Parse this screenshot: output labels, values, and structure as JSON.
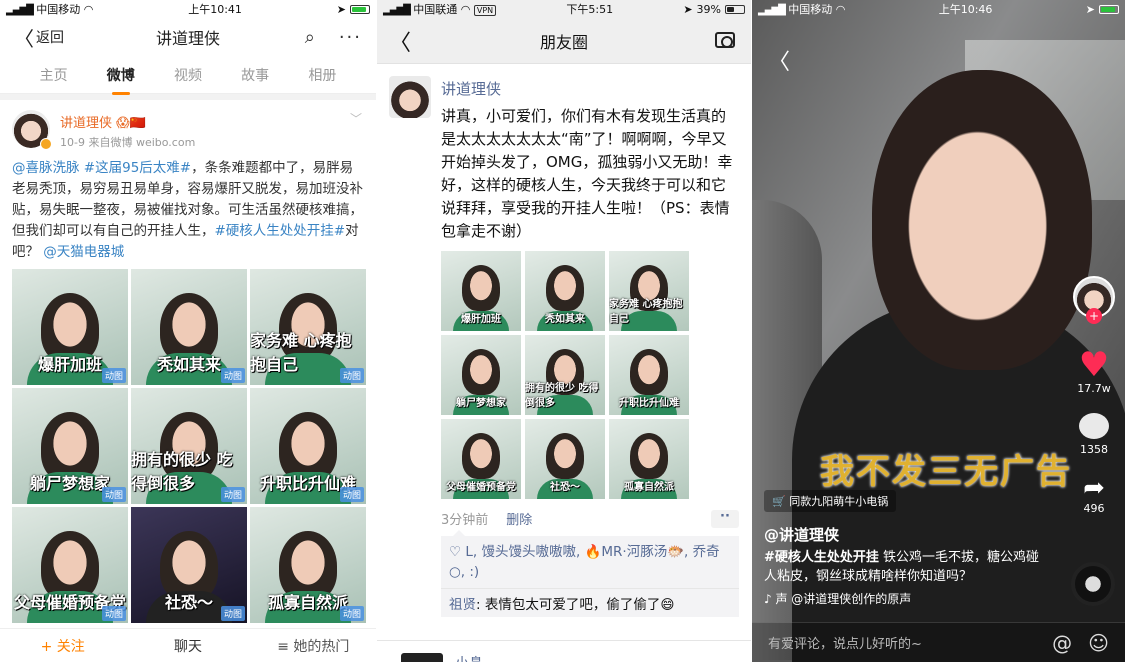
{
  "weibo": {
    "status": {
      "carrier": "中国移动",
      "time": "上午10:41"
    },
    "nav": {
      "back": "返回",
      "title": "讲道理侠"
    },
    "tabs": [
      "主页",
      "微博",
      "视频",
      "故事",
      "相册"
    ],
    "post": {
      "name": "讲道理侠",
      "meta": "10-9  来自微博 weibo.com",
      "text_parts": [
        "@喜脉洗脉",
        "#这届95后太难#",
        "，条条难题都中了，易胖易老易秃顶，易穷易丑易单身，容易爆肝又脱发，易加班没补贴，易失眠一整夜，易被催找对象。可生活虽然硬核难搞，但我们却可以有自己的开挂人生，",
        "#硬核人生处处开挂#",
        "对吧？",
        "@天猫电器城"
      ],
      "images": [
        {
          "caption": "爆肝加班",
          "dark": false
        },
        {
          "caption": "秃如其来",
          "dark": false
        },
        {
          "caption": "家务难 心疼抱抱自己",
          "dark": false
        },
        {
          "caption": "躺尸梦想家",
          "dark": false
        },
        {
          "caption": "拥有的很少 吃得倒很多",
          "dark": false
        },
        {
          "caption": "升职比升仙难",
          "dark": false
        },
        {
          "caption": "父母催婚预备党",
          "dark": false
        },
        {
          "caption": "社恐～",
          "dark": true
        },
        {
          "caption": "孤寡自然派",
          "dark": false
        }
      ],
      "gif_badge": "动图"
    },
    "footer": {
      "follow": "+ 关注",
      "chat": "聊天",
      "hot": "≡ 她的热门"
    }
  },
  "moments": {
    "status": {
      "carrier": "中国联通",
      "vpn": "VPN",
      "time": "下午5:51",
      "battery": "39%"
    },
    "nav": {
      "title": "朋友圈"
    },
    "post": {
      "name": "讲道理侠",
      "text": "讲真，小可爱们，你们有木有发现生活真的是太太太太太太太“南”了！啊啊啊，今早又开始掉头发了，OMG，孤独弱小又无助！幸好，这样的硬核人生，今天我终于可以和它说拜拜，享受我的开挂人生啦！（PS：表情包拿走不谢）",
      "images": [
        {
          "caption": "爆肝加班",
          "dark": false
        },
        {
          "caption": "秃如其来",
          "dark": false
        },
        {
          "caption": "家务难 心疼抱抱自己",
          "dark": false
        },
        {
          "caption": "躺尸梦想家",
          "dark": false
        },
        {
          "caption": "拥有的很少 吃得倒很多",
          "dark": false
        },
        {
          "caption": "升职比升仙难",
          "dark": false
        },
        {
          "caption": "父母催婚预备党",
          "dark": false
        },
        {
          "caption": "社恐～",
          "dark": true
        },
        {
          "caption": "孤寡自然派",
          "dark": false
        }
      ],
      "time": "3分钟前",
      "delete": "删除",
      "likes": "♡ L, 馒头馒头嗷嗷嗷, 🔥MR·河豚汤🐡, 乔奇○, :)",
      "comment_user": "祖贤",
      "comment_text": ": 表情包太可爱了吧，偷了偷了😄"
    },
    "next_name": "小鼻"
  },
  "douyin": {
    "status": {
      "carrier": "中国移动",
      "time": "上午10:46"
    },
    "likes": "17.7w",
    "comments": "1358",
    "shares": "496",
    "overlay_caption": "我不发三无广告",
    "product": "同款九阳萌牛小电锅",
    "user": "@讲道理侠",
    "desc_tag": "#硬核人生处处开挂",
    "desc": " 铁公鸡一毛不拔，糖公鸡碰人粘皮，钢丝球成精啥样你知道吗？",
    "music": "♪ 声    @讲道理侠创作的原声",
    "comment_placeholder": "有爱评论，说点儿好听的~"
  }
}
